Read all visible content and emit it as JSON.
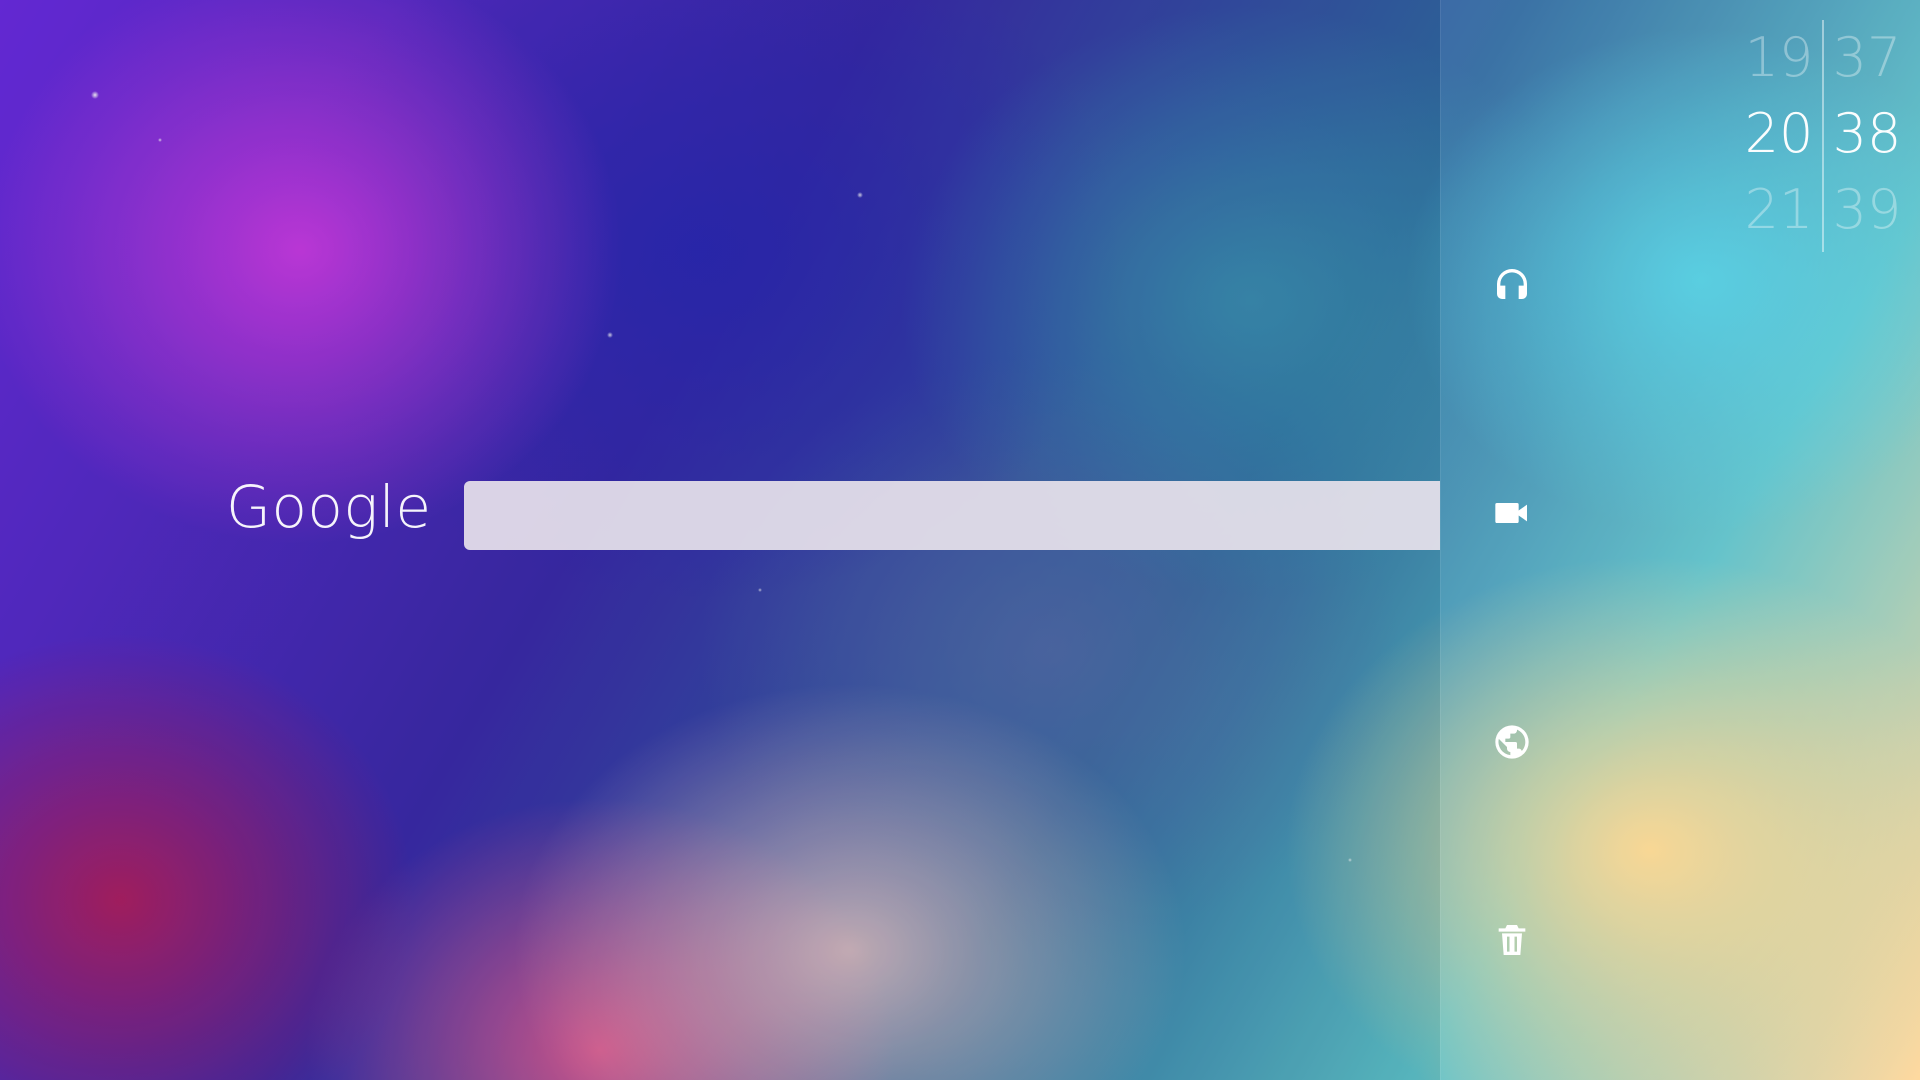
{
  "search": {
    "brand_label": "Google",
    "value": "",
    "placeholder": ""
  },
  "clock": {
    "hours": [
      "19",
      "20",
      "21"
    ],
    "minutes": [
      "37",
      "38",
      "39"
    ],
    "active_hour": "20",
    "active_minute": "38"
  },
  "sidebar": {
    "icons": [
      {
        "name": "headphones-icon"
      },
      {
        "name": "video-camera-icon"
      },
      {
        "name": "globe-icon"
      },
      {
        "name": "trash-icon"
      }
    ]
  },
  "colors": {
    "search_bar": "#E6E1EB",
    "text_primary": "#FFFFFF"
  }
}
